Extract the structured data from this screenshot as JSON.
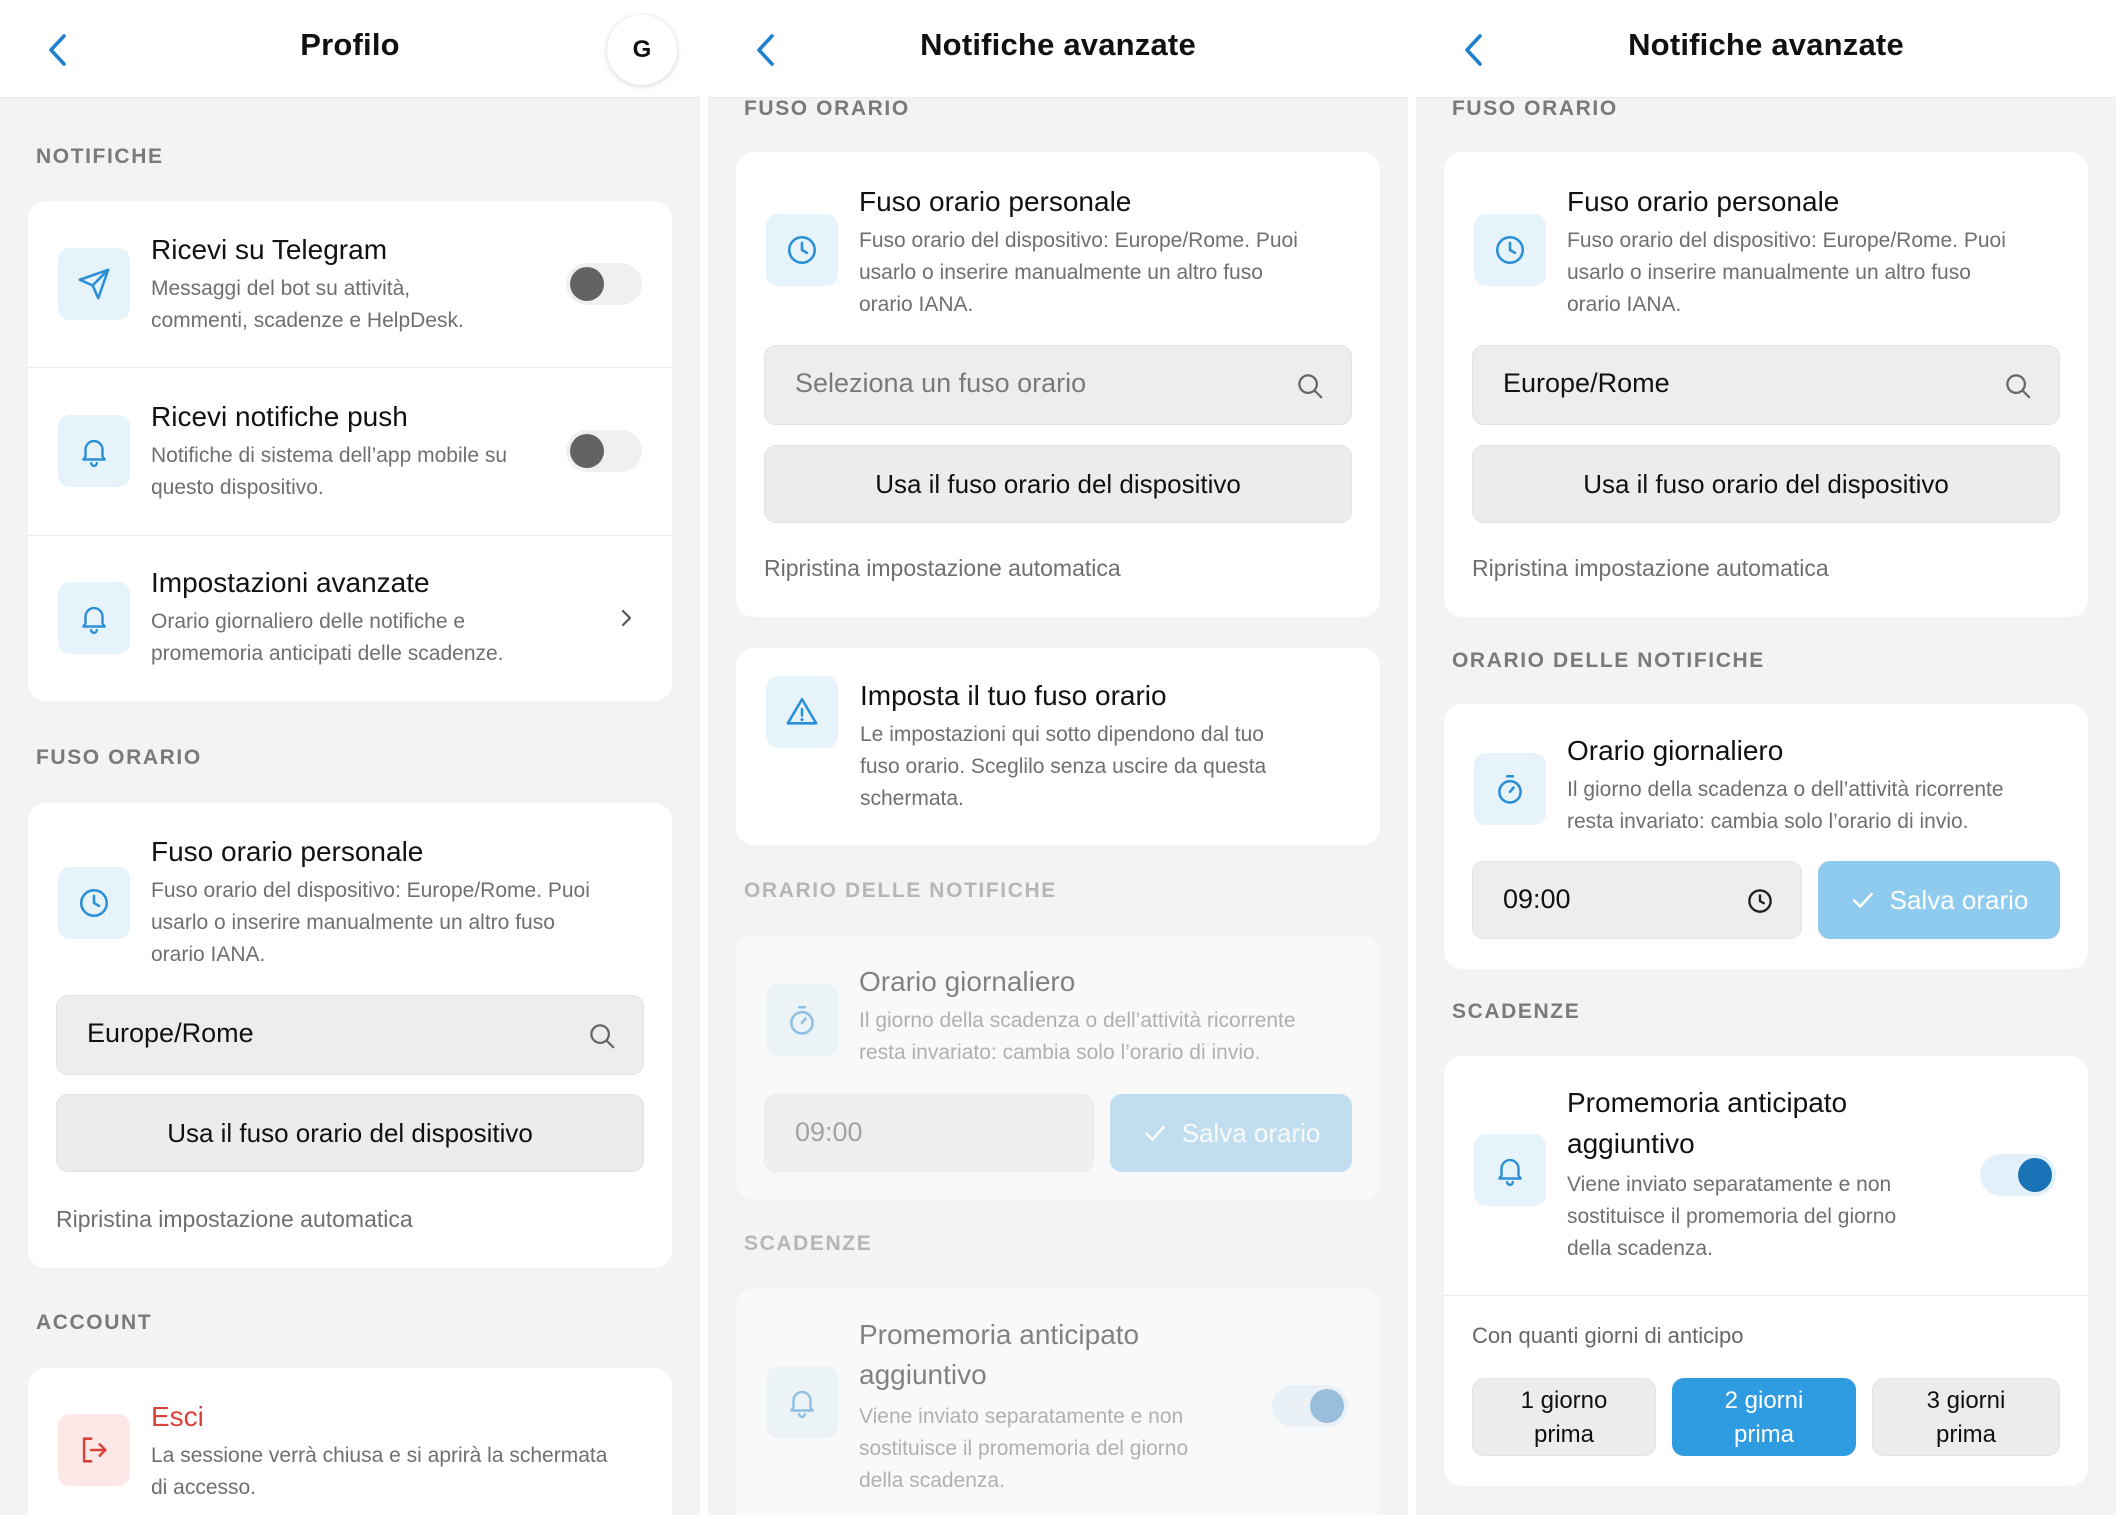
{
  "panels": [
    {
      "title": "Profilo",
      "avatar": "G",
      "notifiche": {
        "section": "NOTIFICHE",
        "items": [
          {
            "title": "Ricevi su Telegram",
            "desc1": "Messaggi del bot su attività,",
            "desc2": "commenti, scadenze e HelpDesk.",
            "toggle": "off"
          },
          {
            "title": "Ricevi notifiche push",
            "desc1": "Notifiche di sistema dell’app mobile su",
            "desc2": "questo dispositivo.",
            "toggle": "off"
          },
          {
            "title": "Impostazioni avanzate",
            "desc1": "Orario giornaliero delle notifiche e",
            "desc2": "promemoria anticipati delle scadenze."
          }
        ]
      },
      "fuso": {
        "section": "FUSO ORARIO",
        "title": "Fuso orario personale",
        "desc1": "Fuso orario del dispositivo: Europe/Rome. Puoi",
        "desc2": "usarlo o inserire manualmente un altro fuso",
        "desc3": "orario IANA.",
        "input_value": "Europe/Rome",
        "use_device": "Usa il fuso orario del dispositivo",
        "reset": "Ripristina impostazione automatica"
      },
      "account": {
        "section": "ACCOUNT",
        "title": "Esci",
        "desc1": "La sessione verrà chiusa e si aprirà la schermata",
        "desc2": "di accesso."
      }
    },
    {
      "title": "Notifiche avanzate",
      "fuso": {
        "section": "FUSO ORARIO",
        "title": "Fuso orario personale",
        "desc1": "Fuso orario del dispositivo: Europe/Rome. Puoi",
        "desc2": "usarlo o inserire manualmente un altro fuso",
        "desc3": "orario IANA.",
        "input_placeholder": "Seleziona un fuso orario",
        "use_device": "Usa il fuso orario del dispositivo",
        "reset": "Ripristina impostazione automatica"
      },
      "warning": {
        "title": "Imposta il tuo fuso orario",
        "desc1": "Le impostazioni qui sotto dipendono dal tuo",
        "desc2": "fuso orario. Sceglilo senza uscire da questa",
        "desc3": "schermata."
      },
      "orario": {
        "section": "ORARIO DELLE NOTIFICHE",
        "title": "Orario giornaliero",
        "desc1": "Il giorno della scadenza o dell’attività ricorrente",
        "desc2": "resta invariato: cambia solo l’orario di invio.",
        "time": "09:00",
        "save": "Salva orario"
      },
      "scadenze": {
        "section": "SCADENZE",
        "title1": "Promemoria anticipato",
        "title2": "aggiuntivo",
        "desc1": "Viene inviato separatamente e non",
        "desc2": "sostituisce il promemoria del giorno",
        "desc3": "della scadenza."
      }
    },
    {
      "title": "Notifiche avanzate",
      "fuso": {
        "section": "FUSO ORARIO",
        "title": "Fuso orario personale",
        "desc1": "Fuso orario del dispositivo: Europe/Rome. Puoi",
        "desc2": "usarlo o inserire manualmente un altro fuso",
        "desc3": "orario IANA.",
        "input_value": "Europe/Rome",
        "use_device": "Usa il fuso orario del dispositivo",
        "reset": "Ripristina impostazione automatica"
      },
      "orario": {
        "section": "ORARIO DELLE NOTIFICHE",
        "title": "Orario giornaliero",
        "desc1": "Il giorno della scadenza o dell’attività ricorrente",
        "desc2": "resta invariato: cambia solo l’orario di invio.",
        "time": "09:00",
        "save": "Salva orario"
      },
      "scadenze": {
        "section": "SCADENZE",
        "title1": "Promemoria anticipato",
        "title2": "aggiuntivo",
        "desc1": "Viene inviato separatamente e non",
        "desc2": "sostituisce il promemoria del giorno",
        "desc3": "della scadenza.",
        "days_label": "Con quanti giorni di anticipo",
        "options": [
          {
            "l1": "1 giorno",
            "l2": "prima"
          },
          {
            "l1": "2 giorni",
            "l2": "prima"
          },
          {
            "l1": "3 giorni",
            "l2": "prima"
          }
        ],
        "selected": "2 giorni prima"
      }
    }
  ],
  "colors": {
    "accent": "#2f9be0",
    "accent_light": "#8ecbef",
    "icon_blue": "#2a8fd6",
    "danger": "#d9423a",
    "background": "#f3f3f3"
  }
}
